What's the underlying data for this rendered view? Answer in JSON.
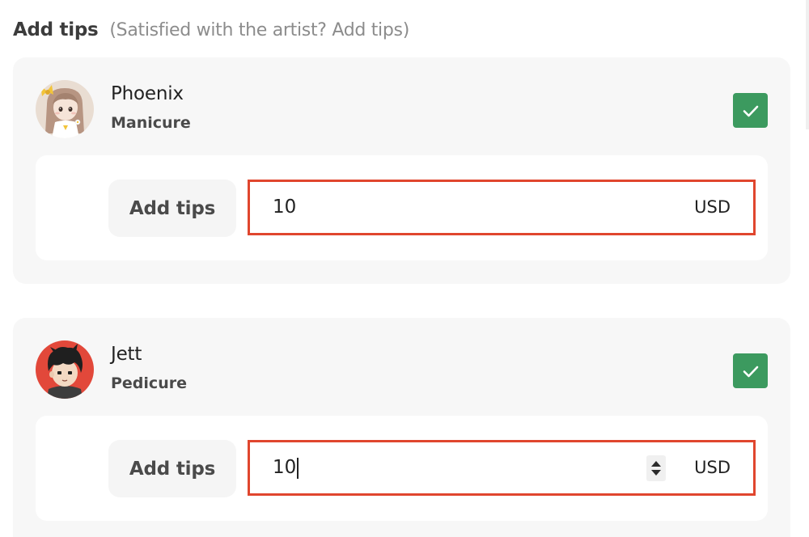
{
  "header": {
    "title": "Add tips",
    "subtitle": "(Satisfied with the artist? Add tips)"
  },
  "artists": [
    {
      "name": "Phoenix",
      "service": "Manicure",
      "checked": true,
      "tip_label": "Add tips",
      "tip_value": "10",
      "currency": "USD",
      "avatar_icon": "girl-avatar-icon"
    },
    {
      "name": "Jett",
      "service": "Pedicure",
      "checked": true,
      "tip_label": "Add tips",
      "tip_value": "10",
      "currency": "USD",
      "avatar_icon": "boy-avatar-icon"
    }
  ],
  "colors": {
    "check_green": "#3c9a5f",
    "highlight_red": "#e0462e",
    "card_bg": "#f7f7f7"
  }
}
